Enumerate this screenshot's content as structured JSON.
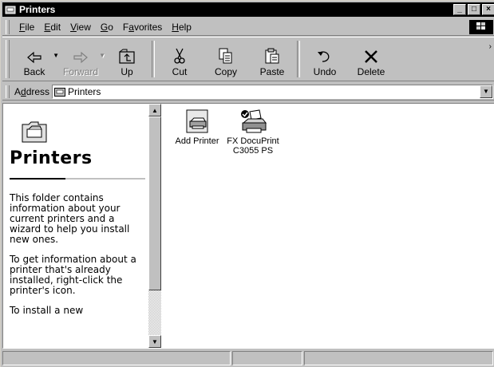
{
  "window": {
    "title": "Printers",
    "controls": [
      "_",
      "□",
      "×"
    ]
  },
  "menu": [
    {
      "label": "File",
      "key": "F",
      "rest": "ile"
    },
    {
      "label": "Edit",
      "key": "E",
      "rest": "dit"
    },
    {
      "label": "View",
      "key": "V",
      "rest": "iew"
    },
    {
      "label": "Go",
      "key": "G",
      "rest": "o"
    },
    {
      "label": "Favorites",
      "pre": "F",
      "key": "a",
      "rest": "vorites"
    },
    {
      "label": "Help",
      "key": "H",
      "rest": "elp"
    }
  ],
  "toolbar": {
    "back": "Back",
    "forward": "Forward",
    "up": "Up",
    "cut": "Cut",
    "copy": "Copy",
    "paste": "Paste",
    "undo": "Undo",
    "delete": "Delete"
  },
  "address": {
    "label_pre": "A",
    "label_key": "d",
    "label_rest": "dress",
    "value": "Printers"
  },
  "left_pane": {
    "title": "Printers",
    "para1": "This folder contains information about your current printers and a wizard to help you install new ones.",
    "para2": "To get information about a printer that's already installed, right-click the printer's icon.",
    "para3": "To install a new"
  },
  "items": [
    {
      "label": "Add Printer",
      "icon": "add-printer-icon"
    },
    {
      "label_line1": "FX DocuPrint",
      "label_line2": "C3055 PS",
      "icon": "default-printer-icon"
    }
  ],
  "colors": {
    "titlebar": "#000000",
    "chrome": "#c0c0c0",
    "content": "#ffffff"
  }
}
